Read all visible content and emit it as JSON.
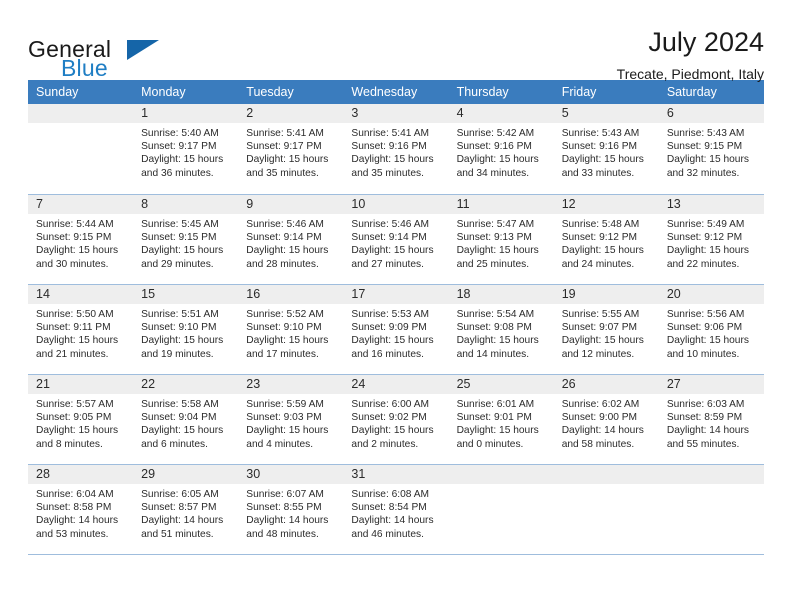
{
  "brand": {
    "name_top": "General",
    "name_bottom": "Blue",
    "accent_color": "#1f7ec4",
    "triangle_color": "#1565a8"
  },
  "header": {
    "title": "July 2024",
    "location": "Trecate, Piedmont, Italy"
  },
  "calendar": {
    "header_bg": "#3a7cbe",
    "daynum_bg": "#eeeeee",
    "border_color": "#9fbddd",
    "weekday_headers": [
      "Sunday",
      "Monday",
      "Tuesday",
      "Wednesday",
      "Thursday",
      "Friday",
      "Saturday"
    ],
    "weeks": [
      [
        {
          "day": "",
          "sunrise": "",
          "sunset": "",
          "daylight_1": "",
          "daylight_2": ""
        },
        {
          "day": "1",
          "sunrise": "Sunrise: 5:40 AM",
          "sunset": "Sunset: 9:17 PM",
          "daylight_1": "Daylight: 15 hours",
          "daylight_2": "and 36 minutes."
        },
        {
          "day": "2",
          "sunrise": "Sunrise: 5:41 AM",
          "sunset": "Sunset: 9:17 PM",
          "daylight_1": "Daylight: 15 hours",
          "daylight_2": "and 35 minutes."
        },
        {
          "day": "3",
          "sunrise": "Sunrise: 5:41 AM",
          "sunset": "Sunset: 9:16 PM",
          "daylight_1": "Daylight: 15 hours",
          "daylight_2": "and 35 minutes."
        },
        {
          "day": "4",
          "sunrise": "Sunrise: 5:42 AM",
          "sunset": "Sunset: 9:16 PM",
          "daylight_1": "Daylight: 15 hours",
          "daylight_2": "and 34 minutes."
        },
        {
          "day": "5",
          "sunrise": "Sunrise: 5:43 AM",
          "sunset": "Sunset: 9:16 PM",
          "daylight_1": "Daylight: 15 hours",
          "daylight_2": "and 33 minutes."
        },
        {
          "day": "6",
          "sunrise": "Sunrise: 5:43 AM",
          "sunset": "Sunset: 9:15 PM",
          "daylight_1": "Daylight: 15 hours",
          "daylight_2": "and 32 minutes."
        }
      ],
      [
        {
          "day": "7",
          "sunrise": "Sunrise: 5:44 AM",
          "sunset": "Sunset: 9:15 PM",
          "daylight_1": "Daylight: 15 hours",
          "daylight_2": "and 30 minutes."
        },
        {
          "day": "8",
          "sunrise": "Sunrise: 5:45 AM",
          "sunset": "Sunset: 9:15 PM",
          "daylight_1": "Daylight: 15 hours",
          "daylight_2": "and 29 minutes."
        },
        {
          "day": "9",
          "sunrise": "Sunrise: 5:46 AM",
          "sunset": "Sunset: 9:14 PM",
          "daylight_1": "Daylight: 15 hours",
          "daylight_2": "and 28 minutes."
        },
        {
          "day": "10",
          "sunrise": "Sunrise: 5:46 AM",
          "sunset": "Sunset: 9:14 PM",
          "daylight_1": "Daylight: 15 hours",
          "daylight_2": "and 27 minutes."
        },
        {
          "day": "11",
          "sunrise": "Sunrise: 5:47 AM",
          "sunset": "Sunset: 9:13 PM",
          "daylight_1": "Daylight: 15 hours",
          "daylight_2": "and 25 minutes."
        },
        {
          "day": "12",
          "sunrise": "Sunrise: 5:48 AM",
          "sunset": "Sunset: 9:12 PM",
          "daylight_1": "Daylight: 15 hours",
          "daylight_2": "and 24 minutes."
        },
        {
          "day": "13",
          "sunrise": "Sunrise: 5:49 AM",
          "sunset": "Sunset: 9:12 PM",
          "daylight_1": "Daylight: 15 hours",
          "daylight_2": "and 22 minutes."
        }
      ],
      [
        {
          "day": "14",
          "sunrise": "Sunrise: 5:50 AM",
          "sunset": "Sunset: 9:11 PM",
          "daylight_1": "Daylight: 15 hours",
          "daylight_2": "and 21 minutes."
        },
        {
          "day": "15",
          "sunrise": "Sunrise: 5:51 AM",
          "sunset": "Sunset: 9:10 PM",
          "daylight_1": "Daylight: 15 hours",
          "daylight_2": "and 19 minutes."
        },
        {
          "day": "16",
          "sunrise": "Sunrise: 5:52 AM",
          "sunset": "Sunset: 9:10 PM",
          "daylight_1": "Daylight: 15 hours",
          "daylight_2": "and 17 minutes."
        },
        {
          "day": "17",
          "sunrise": "Sunrise: 5:53 AM",
          "sunset": "Sunset: 9:09 PM",
          "daylight_1": "Daylight: 15 hours",
          "daylight_2": "and 16 minutes."
        },
        {
          "day": "18",
          "sunrise": "Sunrise: 5:54 AM",
          "sunset": "Sunset: 9:08 PM",
          "daylight_1": "Daylight: 15 hours",
          "daylight_2": "and 14 minutes."
        },
        {
          "day": "19",
          "sunrise": "Sunrise: 5:55 AM",
          "sunset": "Sunset: 9:07 PM",
          "daylight_1": "Daylight: 15 hours",
          "daylight_2": "and 12 minutes."
        },
        {
          "day": "20",
          "sunrise": "Sunrise: 5:56 AM",
          "sunset": "Sunset: 9:06 PM",
          "daylight_1": "Daylight: 15 hours",
          "daylight_2": "and 10 minutes."
        }
      ],
      [
        {
          "day": "21",
          "sunrise": "Sunrise: 5:57 AM",
          "sunset": "Sunset: 9:05 PM",
          "daylight_1": "Daylight: 15 hours",
          "daylight_2": "and 8 minutes."
        },
        {
          "day": "22",
          "sunrise": "Sunrise: 5:58 AM",
          "sunset": "Sunset: 9:04 PM",
          "daylight_1": "Daylight: 15 hours",
          "daylight_2": "and 6 minutes."
        },
        {
          "day": "23",
          "sunrise": "Sunrise: 5:59 AM",
          "sunset": "Sunset: 9:03 PM",
          "daylight_1": "Daylight: 15 hours",
          "daylight_2": "and 4 minutes."
        },
        {
          "day": "24",
          "sunrise": "Sunrise: 6:00 AM",
          "sunset": "Sunset: 9:02 PM",
          "daylight_1": "Daylight: 15 hours",
          "daylight_2": "and 2 minutes."
        },
        {
          "day": "25",
          "sunrise": "Sunrise: 6:01 AM",
          "sunset": "Sunset: 9:01 PM",
          "daylight_1": "Daylight: 15 hours",
          "daylight_2": "and 0 minutes."
        },
        {
          "day": "26",
          "sunrise": "Sunrise: 6:02 AM",
          "sunset": "Sunset: 9:00 PM",
          "daylight_1": "Daylight: 14 hours",
          "daylight_2": "and 58 minutes."
        },
        {
          "day": "27",
          "sunrise": "Sunrise: 6:03 AM",
          "sunset": "Sunset: 8:59 PM",
          "daylight_1": "Daylight: 14 hours",
          "daylight_2": "and 55 minutes."
        }
      ],
      [
        {
          "day": "28",
          "sunrise": "Sunrise: 6:04 AM",
          "sunset": "Sunset: 8:58 PM",
          "daylight_1": "Daylight: 14 hours",
          "daylight_2": "and 53 minutes."
        },
        {
          "day": "29",
          "sunrise": "Sunrise: 6:05 AM",
          "sunset": "Sunset: 8:57 PM",
          "daylight_1": "Daylight: 14 hours",
          "daylight_2": "and 51 minutes."
        },
        {
          "day": "30",
          "sunrise": "Sunrise: 6:07 AM",
          "sunset": "Sunset: 8:55 PM",
          "daylight_1": "Daylight: 14 hours",
          "daylight_2": "and 48 minutes."
        },
        {
          "day": "31",
          "sunrise": "Sunrise: 6:08 AM",
          "sunset": "Sunset: 8:54 PM",
          "daylight_1": "Daylight: 14 hours",
          "daylight_2": "and 46 minutes."
        },
        {
          "day": "",
          "sunrise": "",
          "sunset": "",
          "daylight_1": "",
          "daylight_2": ""
        },
        {
          "day": "",
          "sunrise": "",
          "sunset": "",
          "daylight_1": "",
          "daylight_2": ""
        },
        {
          "day": "",
          "sunrise": "",
          "sunset": "",
          "daylight_1": "",
          "daylight_2": ""
        }
      ]
    ]
  }
}
